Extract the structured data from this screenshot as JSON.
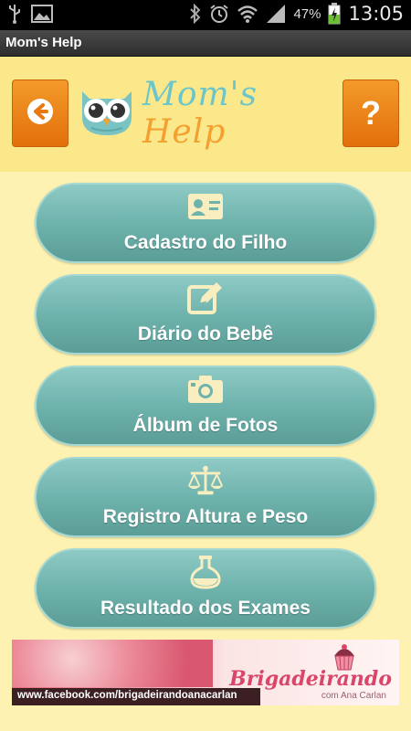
{
  "status_bar": {
    "battery_percent": "47%",
    "time": "13:05",
    "icons": [
      "usb-icon",
      "image-icon",
      "bluetooth-icon",
      "alarm-icon",
      "wifi-icon",
      "signal-icon",
      "battery-charging-icon"
    ]
  },
  "app": {
    "title": "Mom's Help"
  },
  "header": {
    "logo_mom": "Mom's",
    "logo_help": "Help",
    "help_label": "?"
  },
  "menu": {
    "items": [
      {
        "label": "Cadastro do Filho",
        "icon": "id-card-icon"
      },
      {
        "label": "Diário do Bebê",
        "icon": "edit-icon"
      },
      {
        "label": "Álbum de Fotos",
        "icon": "camera-icon"
      },
      {
        "label": "Registro Altura e Peso",
        "icon": "scale-icon"
      },
      {
        "label": "Resultado dos Exames",
        "icon": "flask-icon"
      }
    ]
  },
  "banner": {
    "url": "www.facebook.com/brigadeirandoanacarlan",
    "brand": "Brigadeirando",
    "brand_sub": "com Ana Carlan"
  },
  "colors": {
    "background": "#fdf2b2",
    "header": "#fbe88b",
    "orange_button": "#f39a2a",
    "teal_button": "#6fb3ad",
    "icon_cream": "#f8eec0"
  }
}
